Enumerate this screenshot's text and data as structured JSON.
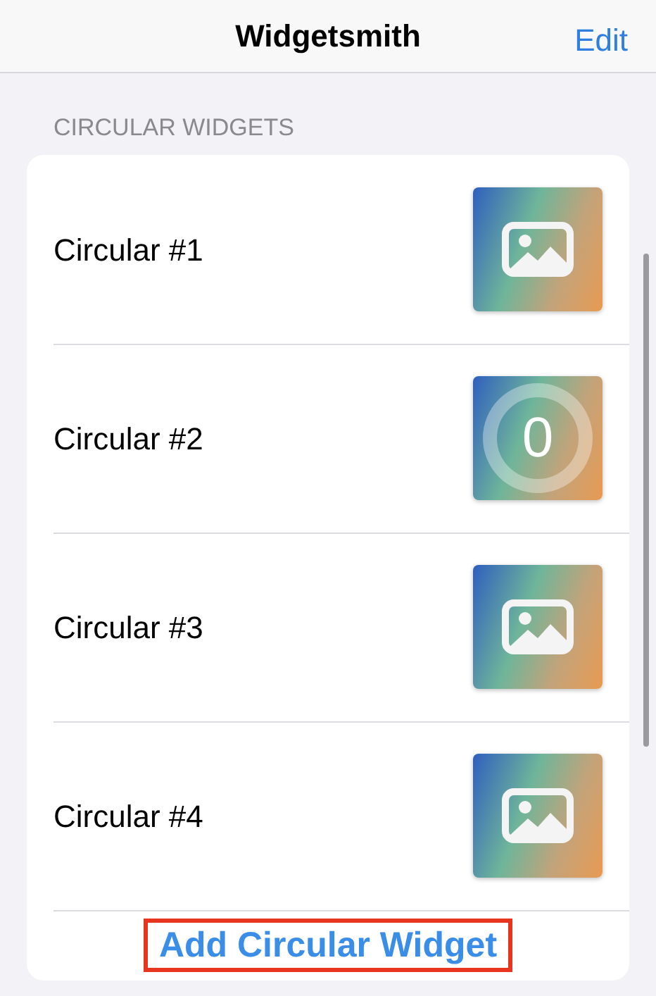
{
  "nav": {
    "title": "Widgetsmith",
    "action": "Edit"
  },
  "section": {
    "header": "CIRCULAR WIDGETS",
    "widgets": [
      {
        "name": "Circular #1",
        "kind": "image"
      },
      {
        "name": "Circular #2",
        "kind": "counter",
        "value": "0"
      },
      {
        "name": "Circular #3",
        "kind": "image"
      },
      {
        "name": "Circular #4",
        "kind": "image"
      }
    ],
    "add_button": {
      "label": "Add Circular Widget",
      "highlighted": true
    }
  }
}
